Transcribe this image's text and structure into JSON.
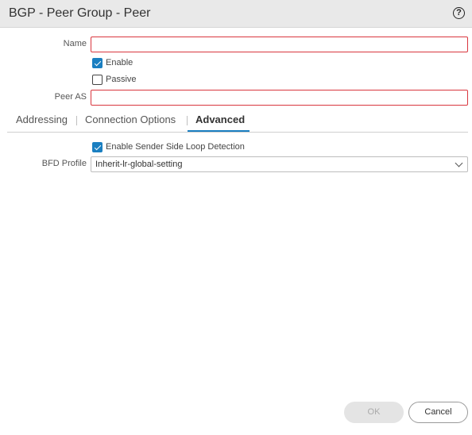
{
  "dialog": {
    "title": "BGP - Peer Group - Peer",
    "help_icon": "?"
  },
  "form": {
    "name_label": "Name",
    "name_value": "",
    "enable_label": "Enable",
    "enable_checked": true,
    "passive_label": "Passive",
    "passive_checked": false,
    "peer_as_label": "Peer AS",
    "peer_as_value": ""
  },
  "tabs": [
    {
      "label": "Addressing",
      "active": false
    },
    {
      "label": "Connection Options",
      "active": false
    },
    {
      "label": "Advanced",
      "active": true
    }
  ],
  "advanced": {
    "loop_detection_label": "Enable Sender Side Loop Detection",
    "loop_detection_checked": true,
    "bfd_profile_label": "BFD Profile",
    "bfd_profile_value": "Inherit-lr-global-setting"
  },
  "buttons": {
    "ok_label": "OK",
    "cancel_label": "Cancel"
  },
  "colors": {
    "accent": "#1a7fc1",
    "error_border": "#d9363e",
    "title_bar": "#e9e9e9"
  }
}
